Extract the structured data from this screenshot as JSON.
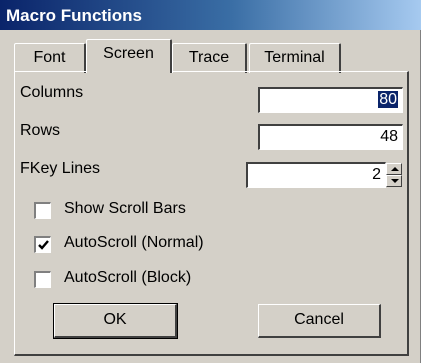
{
  "window": {
    "title": "Macro Functions"
  },
  "tabs": [
    {
      "label": "Font",
      "active": false
    },
    {
      "label": "Screen",
      "active": true
    },
    {
      "label": "Trace",
      "active": false
    },
    {
      "label": "Terminal",
      "active": false
    }
  ],
  "screen": {
    "columns": {
      "label": "Columns",
      "value": "80"
    },
    "rows": {
      "label": "Rows",
      "value": "48"
    },
    "fkey_lines": {
      "label": "FKey Lines",
      "value": "2"
    },
    "options": [
      {
        "label": "Show Scroll Bars",
        "checked": false
      },
      {
        "label": "AutoScroll (Normal)",
        "checked": true
      },
      {
        "label": "AutoScroll (Block)",
        "checked": false
      }
    ]
  },
  "buttons": {
    "ok": "OK",
    "cancel": "Cancel"
  }
}
